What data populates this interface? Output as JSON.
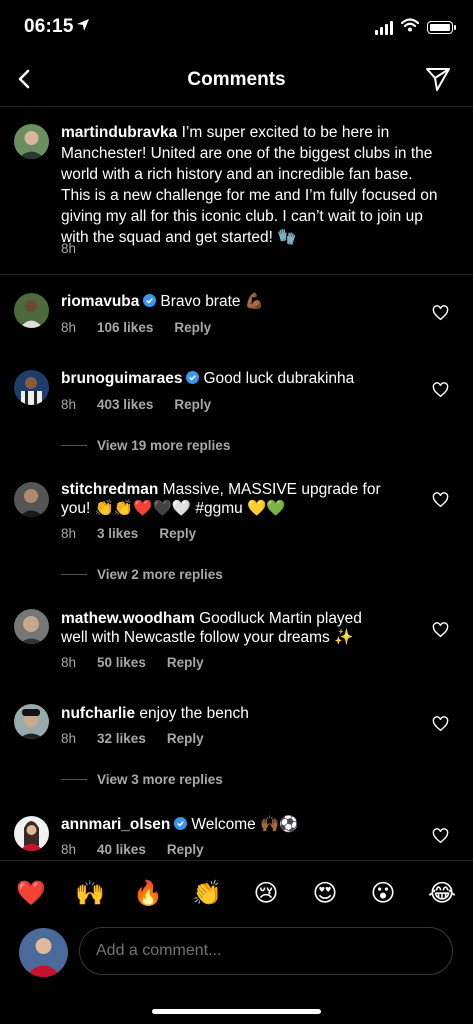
{
  "status": {
    "time": "06:15"
  },
  "header": {
    "title": "Comments"
  },
  "caption": {
    "username": "martindubravka",
    "text": " I’m super excited to be here in Manchester! United are one of the biggest clubs in the world with a rich history and an incredible fan base. This is a new challenge for me and I’m fully focused on giving my all for this iconic club. I can’t wait to join up with the squad and get started! 🧤",
    "time": "8h"
  },
  "comments": [
    {
      "username": "riomavuba",
      "verified": true,
      "text": "Bravo brate 💪🏾",
      "time": "8h",
      "likes": "106 likes",
      "reply": "Reply"
    },
    {
      "username": "brunoguimaraes",
      "verified": true,
      "text": "Good luck dubrakinha",
      "time": "8h",
      "likes": "403 likes",
      "reply": "Reply",
      "more_replies": "View 19 more replies"
    },
    {
      "username": "stitchredman",
      "verified": false,
      "text": "Massive, MASSIVE upgrade for you! 👏👏❤️🖤🤍 #ggmu 💛💚",
      "time": "8h",
      "likes": "3 likes",
      "reply": "Reply",
      "more_replies": "View 2 more replies"
    },
    {
      "username": "mathew.woodham",
      "verified": false,
      "text": "Goodluck Martin played well with Newcastle follow your dreams ✨",
      "time": "8h",
      "likes": "50 likes",
      "reply": "Reply"
    },
    {
      "username": "nufcharlie",
      "verified": false,
      "text": "enjoy the bench",
      "time": "8h",
      "likes": "32 likes",
      "reply": "Reply",
      "more_replies": "View 3 more replies"
    },
    {
      "username": "annmari_olsen",
      "verified": true,
      "text": "Welcome 🙌🏾⚽",
      "time": "8h",
      "likes": "40 likes",
      "reply": "Reply"
    }
  ],
  "quick_emojis": [
    "❤️",
    "🙌",
    "🔥",
    "👏",
    "😢",
    "😍",
    "😮",
    "😂"
  ],
  "composer": {
    "placeholder": "Add a comment..."
  },
  "colors": {
    "background": "#000000",
    "secondary_text": "#a8a8a8",
    "verified": "#3897f0",
    "divider": "#262626"
  }
}
